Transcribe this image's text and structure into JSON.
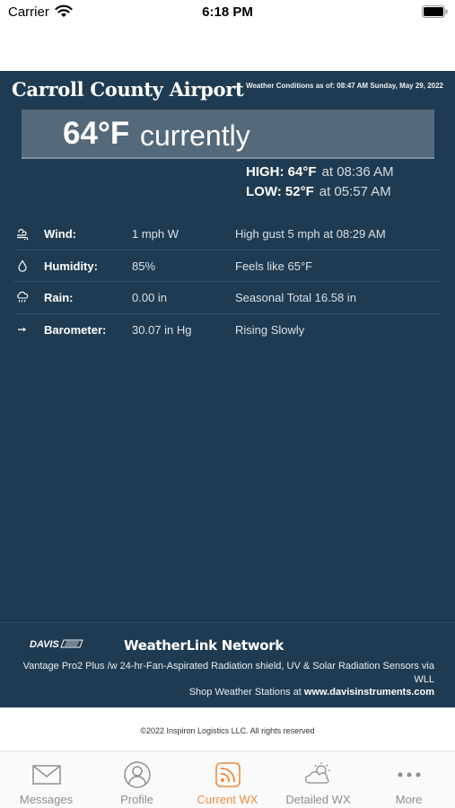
{
  "status_bar": {
    "carrier": "Carrier",
    "time": "6:18 PM"
  },
  "station": {
    "name": "Carroll County Airport",
    "as_of": "Weather Conditions as of: 08:47 AM Sunday, May 29, 2022"
  },
  "current": {
    "temp": "64°F",
    "word": "currently"
  },
  "high": {
    "label": "HIGH:",
    "value": "64°F",
    "time": "at 08:36 AM"
  },
  "low": {
    "label": "LOW:",
    "value": "52°F",
    "time": "at 05:57 AM"
  },
  "conditions": [
    {
      "icon": "wind-icon",
      "name": "Wind:",
      "value": "1 mph W",
      "extra": "High gust 5 mph at 08:29 AM"
    },
    {
      "icon": "humidity-icon",
      "name": "Humidity:",
      "value": "85%",
      "extra": "Feels like 65°F"
    },
    {
      "icon": "rain-icon",
      "name": "Rain:",
      "value": "0.00 in",
      "extra": "Seasonal Total 16.58 in"
    },
    {
      "icon": "barometer-icon",
      "name": "Barometer:",
      "value": "30.07 in Hg",
      "extra": "Rising Slowly"
    }
  ],
  "footer": {
    "logo_text": "DAVIS",
    "network": "WeatherLink Network",
    "station_desc": "Vantage Pro2 Plus /w 24-hr-Fan-Aspirated Radiation shield, UV & Solar Radiation Sensors via WLL",
    "shop_prefix": "Shop Weather Stations at",
    "shop_link": "www.davisinstruments.com"
  },
  "copyright": "©2022 Inspiron Logistics LLC. All rights reserved",
  "tabs": [
    {
      "label": "Messages",
      "icon": "envelope-icon",
      "active": false
    },
    {
      "label": "Profile",
      "icon": "person-icon",
      "active": false
    },
    {
      "label": "Current WX",
      "icon": "feed-icon",
      "active": true
    },
    {
      "label": "Detailed WX",
      "icon": "cloud-sun-icon",
      "active": false
    },
    {
      "label": "More",
      "icon": "more-dots-icon",
      "active": false
    }
  ],
  "colors": {
    "panel_bg": "#1f3b51",
    "current_box": "#54697a",
    "accent": "#f08a3c",
    "tab_inactive": "#8e8e93"
  }
}
